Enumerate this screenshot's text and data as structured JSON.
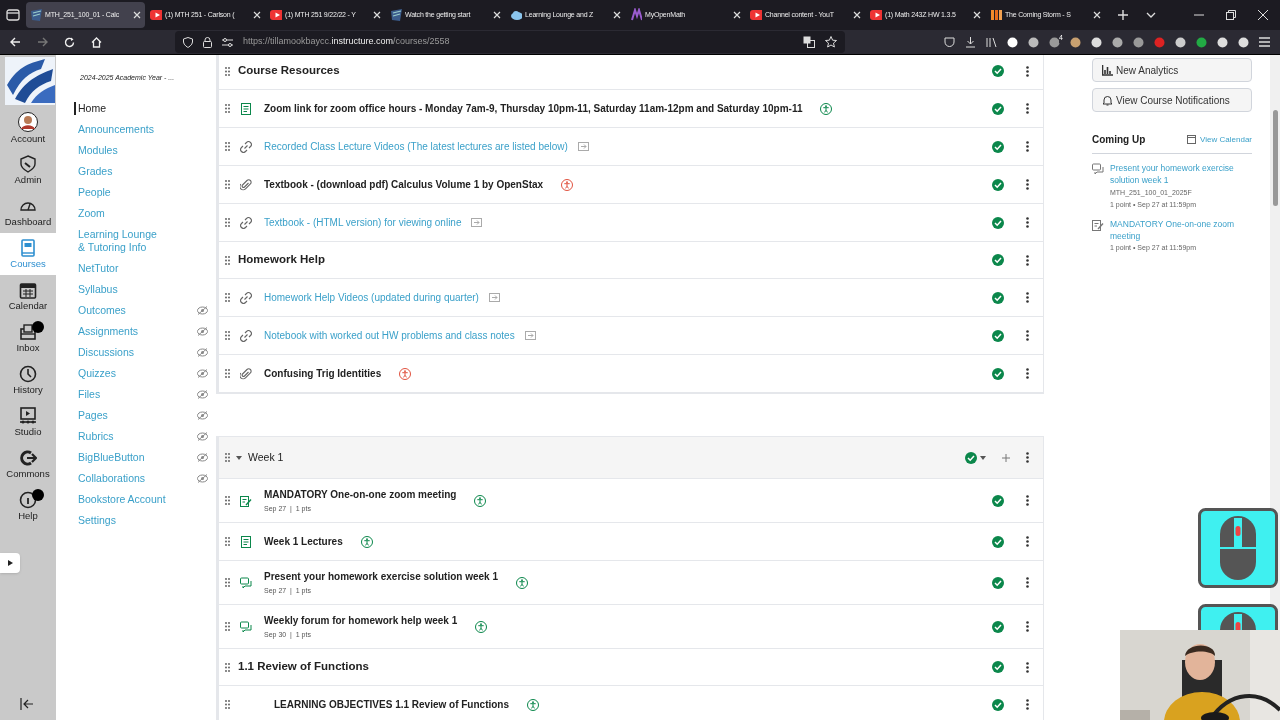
{
  "browser": {
    "tabs": [
      {
        "title": "MTH_251_100_01 - Calc",
        "kind": "canvas",
        "selected": true
      },
      {
        "title": "(1) MTH 251 - Carlson (",
        "kind": "youtube",
        "selected": false
      },
      {
        "title": "(1) MTH 251 9/22/22 - Y",
        "kind": "youtube",
        "selected": false
      },
      {
        "title": "Watch the getting start",
        "kind": "canvas",
        "selected": false
      },
      {
        "title": "Learning Lounge and Z",
        "kind": "cloud",
        "selected": false
      },
      {
        "title": "MyOpenMath",
        "kind": "myopenmath",
        "selected": false
      },
      {
        "title": "Channel content - YouT",
        "kind": "youtube",
        "selected": false
      },
      {
        "title": "(1) Math 243Z HW 1.3.5",
        "kind": "youtube",
        "selected": false
      },
      {
        "title": "The Coming Storm - S",
        "kind": "storm",
        "selected": false
      }
    ],
    "url_prefix": "https://tillamookbaycc.",
    "url_domain": "instructure.com",
    "url_path": "/courses/2558",
    "extension_badge": "4"
  },
  "global_nav": [
    {
      "label": "Account",
      "kind": "avatar",
      "selected": false,
      "badge": false
    },
    {
      "label": "Admin",
      "kind": "admin",
      "selected": false,
      "badge": false
    },
    {
      "label": "Dashboard",
      "kind": "dashboard",
      "selected": false,
      "badge": false
    },
    {
      "label": "Courses",
      "kind": "courses",
      "selected": true,
      "badge": false
    },
    {
      "label": "Calendar",
      "kind": "calendar",
      "selected": false,
      "badge": false
    },
    {
      "label": "Inbox",
      "kind": "inbox",
      "selected": false,
      "badge": true
    },
    {
      "label": "History",
      "kind": "history",
      "selected": false,
      "badge": false
    },
    {
      "label": "Studio",
      "kind": "studio",
      "selected": false,
      "badge": false
    },
    {
      "label": "Commons",
      "kind": "commons",
      "selected": false,
      "badge": false
    },
    {
      "label": "Help",
      "kind": "help",
      "selected": false,
      "badge": true
    }
  ],
  "course_nav": {
    "term": "2024-2025 Academic Year - ...",
    "items": [
      {
        "label": "Home",
        "selected": true,
        "hidden": false
      },
      {
        "label": "Announcements",
        "selected": false,
        "hidden": false
      },
      {
        "label": "Modules",
        "selected": false,
        "hidden": false
      },
      {
        "label": "Grades",
        "selected": false,
        "hidden": false
      },
      {
        "label": "People",
        "selected": false,
        "hidden": false
      },
      {
        "label": "Zoom",
        "selected": false,
        "hidden": false
      },
      {
        "label": "Learning Lounge & Tutoring Info",
        "selected": false,
        "hidden": false
      },
      {
        "label": "NetTutor",
        "selected": false,
        "hidden": false
      },
      {
        "label": "Syllabus",
        "selected": false,
        "hidden": false
      },
      {
        "label": "Outcomes",
        "selected": false,
        "hidden": true
      },
      {
        "label": "Assignments",
        "selected": false,
        "hidden": true
      },
      {
        "label": "Discussions",
        "selected": false,
        "hidden": true
      },
      {
        "label": "Quizzes",
        "selected": false,
        "hidden": true
      },
      {
        "label": "Files",
        "selected": false,
        "hidden": true
      },
      {
        "label": "Pages",
        "selected": false,
        "hidden": true
      },
      {
        "label": "Rubrics",
        "selected": false,
        "hidden": true
      },
      {
        "label": "BigBlueButton",
        "selected": false,
        "hidden": true
      },
      {
        "label": "Collaborations",
        "selected": false,
        "hidden": true
      },
      {
        "label": "Bookstore Account",
        "selected": false,
        "hidden": false
      },
      {
        "label": "Settings",
        "selected": false,
        "hidden": false
      }
    ]
  },
  "modules": [
    {
      "items": [
        {
          "kind": "subheader",
          "title": "Course Resources",
          "published": true
        },
        {
          "kind": "page",
          "title": "Zoom link for zoom office hours - Monday 7am-9, Thursday 10pm-11, Saturday 11am-12pm and Saturday 10pm-11",
          "accessibility_issue": false,
          "published": true
        },
        {
          "kind": "external",
          "title": "Recorded Class Lecture Videos (The latest lectures are listed below)",
          "published": true
        },
        {
          "kind": "file",
          "title": "Textbook - (download pdf) Calculus Volume 1 by OpenStax",
          "accessibility_issue": true,
          "published": true
        },
        {
          "kind": "external",
          "title": "Textbook - (HTML version) for viewing online",
          "published": true
        },
        {
          "kind": "subheader",
          "title": "Homework Help",
          "published": true
        },
        {
          "kind": "external",
          "title": "Homework Help Videos (updated during quarter)",
          "published": true
        },
        {
          "kind": "external",
          "title": "Notebook with worked out HW problems and class notes",
          "published": true
        },
        {
          "kind": "file",
          "title": "Confusing Trig Identities",
          "accessibility_issue": true,
          "published": true
        }
      ]
    },
    {
      "title": "Week 1",
      "expanded": true,
      "published": true,
      "items": [
        {
          "kind": "assignment",
          "title": "MANDATORY One-on-one zoom meeting",
          "meta": "Sep 27  |  1 pts",
          "accessibility_issue": false,
          "published": true
        },
        {
          "kind": "page",
          "title": "Week 1 Lectures",
          "accessibility_issue": false,
          "published": true
        },
        {
          "kind": "discussion",
          "title": "Present your homework exercise solution week 1",
          "meta": "Sep 27  |  1 pts",
          "accessibility_issue": false,
          "published": true
        },
        {
          "kind": "discussion",
          "title": "Weekly forum for homework help week 1",
          "meta": "Sep 30  |  1 pts",
          "accessibility_issue": false,
          "published": true
        },
        {
          "kind": "subheader",
          "title": "1.1 Review of Functions",
          "published": true
        },
        {
          "kind": "subsub",
          "title": "LEARNING OBJECTIVES 1.1 Review of Functions",
          "accessibility_issue": false,
          "published": true
        }
      ]
    }
  ],
  "sidebar": {
    "buttons": [
      {
        "label": "New Analytics"
      },
      {
        "label": "View Course Notifications"
      }
    ],
    "coming_up": {
      "title": "Coming Up",
      "link": "View Calendar",
      "items": [
        {
          "kind": "discussion",
          "title": "Present your homework exercise solution week 1",
          "course": "MTH_251_100_01_2025F",
          "meta": "1 point • Sep 27 at 11:59pm"
        },
        {
          "kind": "assignment",
          "title": "MANDATORY One-on-one zoom meeting",
          "meta": "1 point • Sep 27 at 11:59pm"
        }
      ]
    }
  }
}
